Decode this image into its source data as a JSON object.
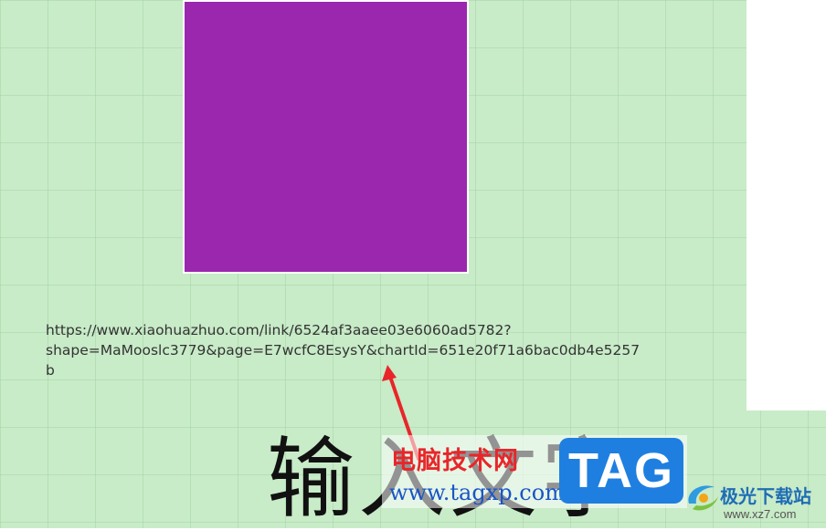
{
  "canvas": {
    "background_color": "#c8ebc8",
    "square_color": "#9b27af",
    "link_text": "https://www.xiaohuazhuo.com/link/6524af3aaee03e6060ad5782?\nshape=MaMooslc3779&page=E7wcfC8EsysY&chartId=651e20f71a6bac0db4e5257\nb",
    "big_text": "输入文字",
    "arrow_color": "#e8262a"
  },
  "watermark": {
    "site_name": "电脑技术网",
    "site_url": "www.tagxp.com",
    "tag_label": "TAG",
    "secondary_name": "极光下载站",
    "secondary_url": "www.xz7.com"
  }
}
